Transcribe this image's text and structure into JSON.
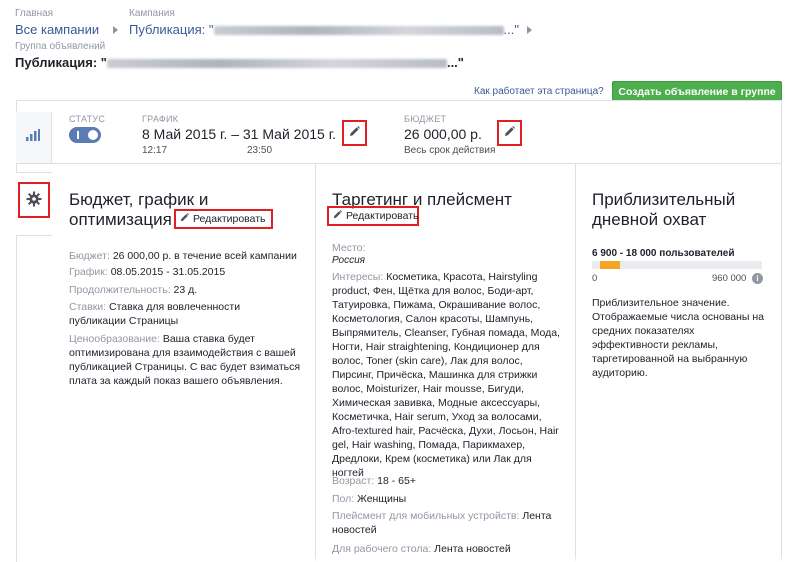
{
  "breadcrumbs": {
    "level1_caption": "Главная",
    "level1_link": "Все кампании",
    "level2_caption": "Кампания",
    "level2_prefix": "Публикация: \"",
    "level2_suffix": "...\"",
    "level3_caption": "Группа объявлений"
  },
  "page_title": {
    "prefix": "Публикация: \"",
    "suffix": "...\""
  },
  "toolbar": {
    "how_link": "Как работает эта страница?",
    "create_button": "Создать объявление в группе"
  },
  "summary": {
    "status_caption": "СТАТУС",
    "schedule_caption": "ГРАФИК",
    "schedule_range": "8 Май 2015 г. – 31 Май 2015 г.",
    "schedule_start_time": "12:17",
    "schedule_end_time": "23:50",
    "budget_caption": "БЮДЖЕТ",
    "budget_value": "26 000,00 р.",
    "budget_period": "Весь срок действия"
  },
  "budget_section": {
    "title": "Бюджет, график и оптимизация",
    "edit_label": "Редактировать",
    "budget_key": "Бюджет:",
    "budget_val": "26 000,00 р. в течение всей кампании",
    "schedule_key": "График:",
    "schedule_val": "08.05.2015 - 31.05.2015",
    "duration_key": "Продолжительность:",
    "duration_val": "23 д.",
    "bid_key": "Ставки:",
    "bid_val": "Ставка для вовлеченности публикации Страницы",
    "opt_key": "Ценообразование:",
    "opt_val": "Ваша ставка будет оптимизирована для взаимодействия с вашей публикацией Страницы. С вас будет взиматься плата за каждый показ вашего объявления."
  },
  "targeting_section": {
    "title": "Таргетинг и плейсмент",
    "edit_label": "Редактировать",
    "place_key": "Место:",
    "place_val": "Россия",
    "interests_key": "Интересы:",
    "interests_val": "Косметика, Красота, Hairstyling product, Фен, Щётка для волос, Боди-арт, Татуировка, Пижама, Окрашивание волос, Косметология, Салон красоты, Шампунь, Выпрямитель, Cleanser, Губная помада, Мода, Ногти, Hair straightening, Кондиционер для волос, Toner (skin care), Лак для волос, Пирсинг, Причёска, Машинка для стрижки волос, Moisturizer, Hair mousse, Бигуди, Химическая завивка, Модные аксессуары, Косметичка, Hair serum, Уход за волосами, Afro-textured hair, Расчёска, Духи, Лосьон, Hair gel, Hair washing, Помада, Парикмахер, Дредлоки, Крем (косметика) или Лак для ногтей",
    "age_key": "Возраст:",
    "age_val": "18 - 65+",
    "gender_key": "Пол:",
    "gender_val": "Женщины",
    "mobile_key": "Плейсмент для мобильных устройств:",
    "mobile_val": "Лента новостей",
    "desktop_key": "Для рабочего стола:",
    "desktop_val": "Лента новостей"
  },
  "reach_section": {
    "title": "Приблизительный дневной охват",
    "range": "6 900 - 18 000 пользователей",
    "min": "0",
    "max": "960 000",
    "info": "i",
    "note": "Приблизительное значение. Отображаемые числа основаны на средних показателях эффективности рекламы, таргетированной на выбранную аудиторию."
  },
  "colors": {
    "accent": "#3b5998",
    "create_button": "#4cae4c",
    "highlight": "#e02020",
    "reach_fill": "#f5a623"
  }
}
